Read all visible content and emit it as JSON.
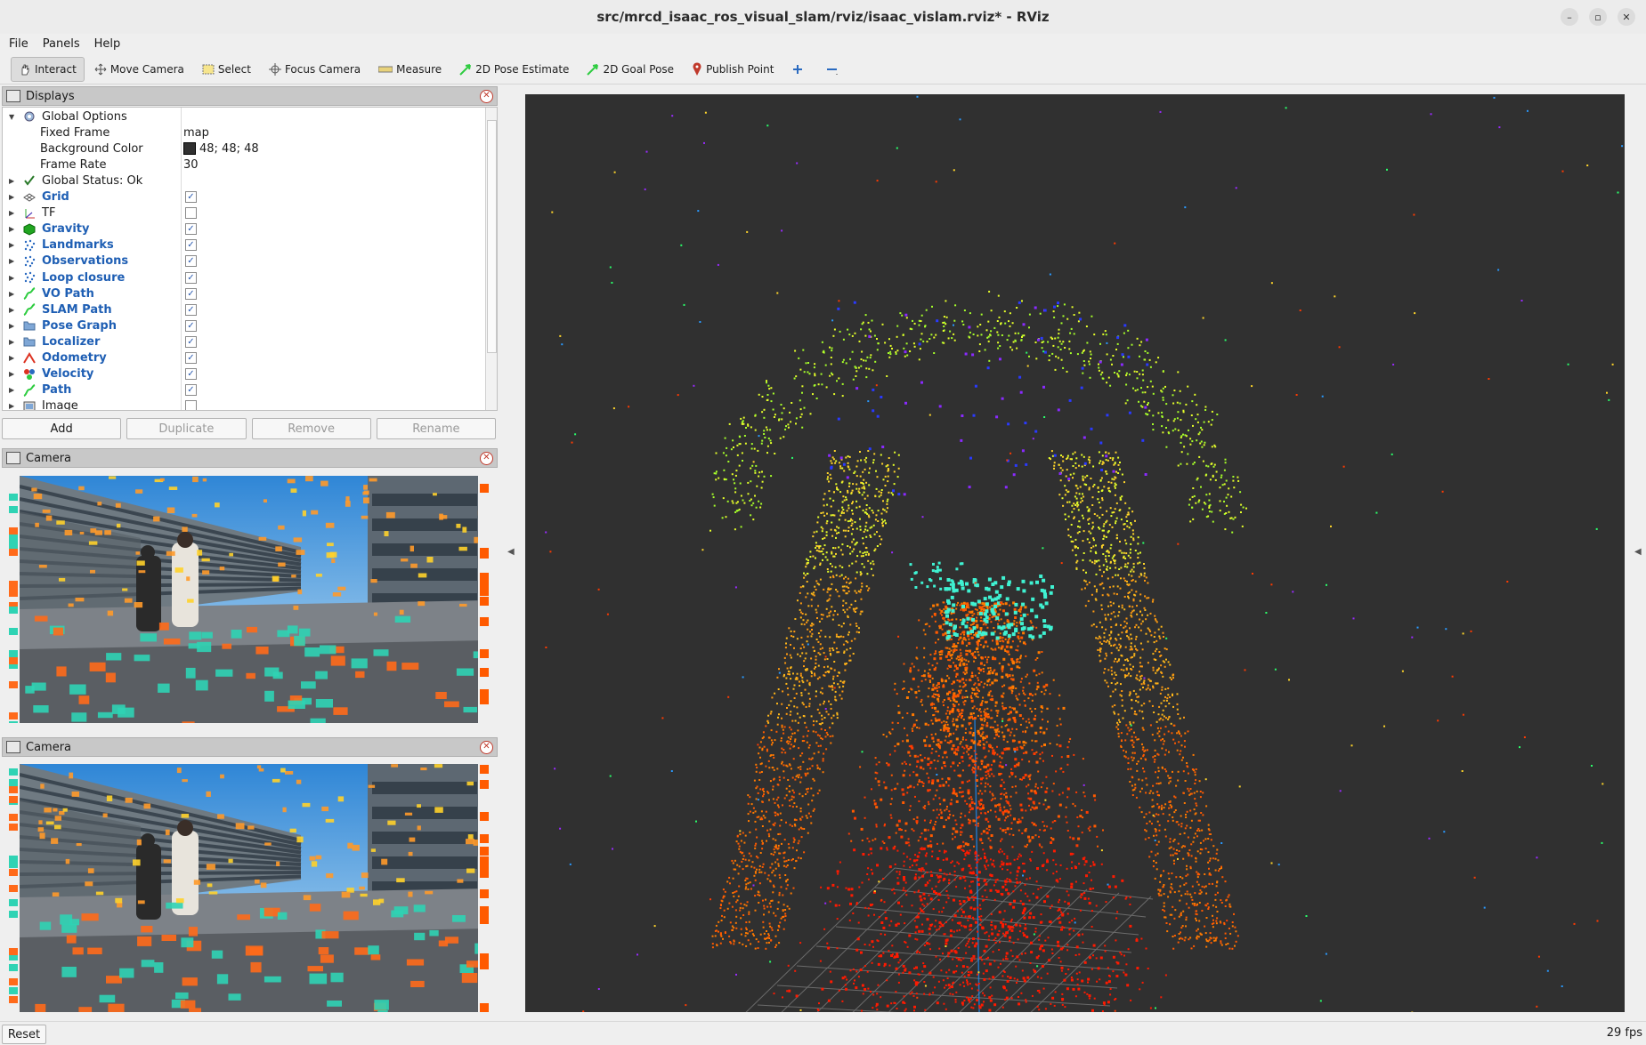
{
  "window": {
    "title": "src/mrcd_isaac_ros_visual_slam/rviz/isaac_vislam.rviz* - RViz"
  },
  "menu": [
    "File",
    "Panels",
    "Help"
  ],
  "toolbar": [
    {
      "label": "Interact",
      "icon": "hand-icon",
      "active": true
    },
    {
      "label": "Move Camera",
      "icon": "move-camera-icon"
    },
    {
      "label": "Select",
      "icon": "select-icon"
    },
    {
      "label": "Focus Camera",
      "icon": "focus-camera-icon"
    },
    {
      "label": "Measure",
      "icon": "ruler-icon"
    },
    {
      "label": "2D Pose Estimate",
      "icon": "pose-arrow-icon"
    },
    {
      "label": "2D Goal Pose",
      "icon": "goal-arrow-icon"
    },
    {
      "label": "Publish Point",
      "icon": "pin-icon"
    }
  ],
  "displays": {
    "title": "Displays",
    "global_options": {
      "label": "Global Options",
      "fixed_frame": {
        "label": "Fixed Frame",
        "value": "map"
      },
      "background_color": {
        "label": "Background Color",
        "value": "48; 48; 48",
        "swatch": "#303030"
      },
      "frame_rate": {
        "label": "Frame Rate",
        "value": "30"
      }
    },
    "global_status": "Global Status: Ok",
    "items": [
      {
        "label": "Grid",
        "checked": true,
        "bold": true
      },
      {
        "label": "TF",
        "checked": false,
        "bold": false
      },
      {
        "label": "Gravity",
        "checked": true,
        "bold": true
      },
      {
        "label": "Landmarks",
        "checked": true,
        "bold": true
      },
      {
        "label": "Observations",
        "checked": true,
        "bold": true
      },
      {
        "label": "Loop closure",
        "checked": true,
        "bold": true
      },
      {
        "label": "VO Path",
        "checked": true,
        "bold": true
      },
      {
        "label": "SLAM Path",
        "checked": true,
        "bold": true
      },
      {
        "label": "Pose Graph",
        "checked": true,
        "bold": true
      },
      {
        "label": "Localizer",
        "checked": true,
        "bold": true
      },
      {
        "label": "Odometry",
        "checked": true,
        "bold": true
      },
      {
        "label": "Velocity",
        "checked": true,
        "bold": true
      },
      {
        "label": "Path",
        "checked": true,
        "bold": true
      },
      {
        "label": "Image",
        "checked": false,
        "bold": false
      }
    ],
    "buttons": {
      "add": "Add",
      "duplicate": "Duplicate",
      "remove": "Remove",
      "rename": "Rename"
    }
  },
  "camera_panels": [
    "Camera",
    "Camera"
  ],
  "status": {
    "reset": "Reset",
    "fps": "29 fps"
  },
  "colors": {
    "viewport_bg": "#303030",
    "checkbox_blue": "#2a5ab0",
    "display_blue": "#1f5fb4"
  }
}
